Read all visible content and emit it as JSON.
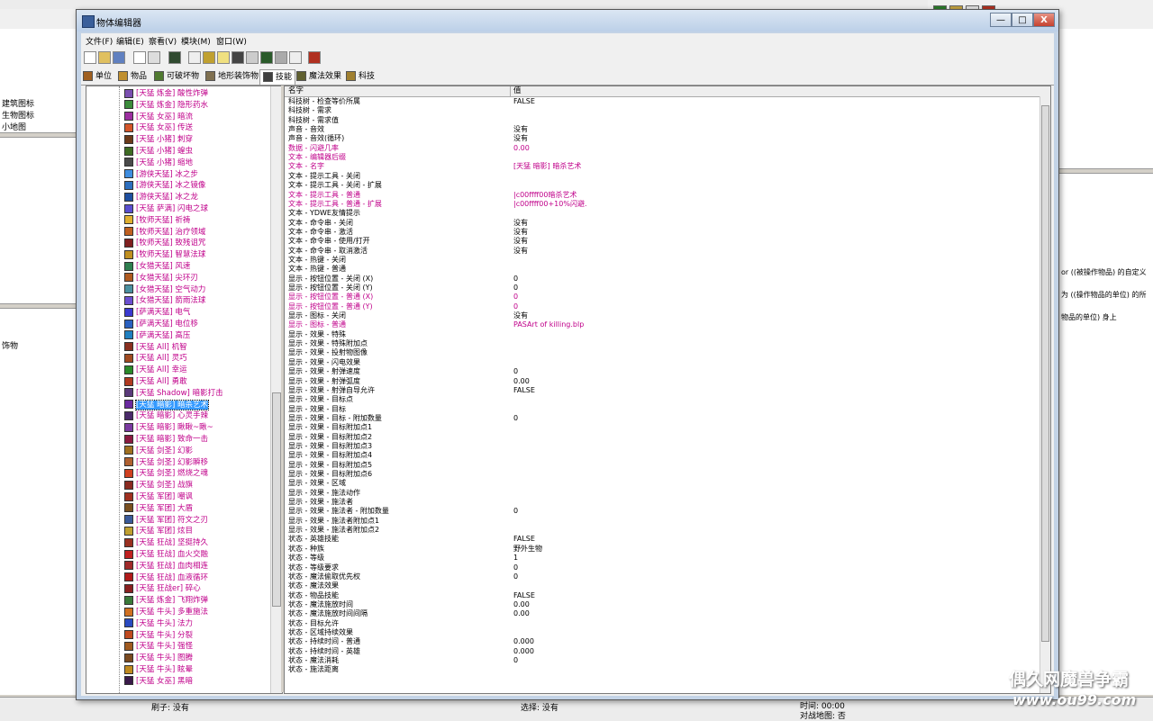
{
  "window": {
    "title": "物体编辑器",
    "controls": {
      "minimize": "—",
      "maximize": "□",
      "close": "X"
    }
  },
  "menu": [
    "文件(F)",
    "编辑(E)",
    "察看(V)",
    "模块(M)",
    "窗口(W)"
  ],
  "tabs": [
    "单位",
    "物品",
    "可破坏物",
    "地形装饰物",
    "技能",
    "魔法效果",
    "科技"
  ],
  "active_tab": 4,
  "tree_items": [
    {
      "label": "[天猛 炼金] 酸性炸弹",
      "color": "#7a4fb0"
    },
    {
      "label": "[天猛 炼金] 隐形药水",
      "color": "#3c8c3c"
    },
    {
      "label": "[天猛 女巫] 暗流",
      "color": "#9c2fa0"
    },
    {
      "label": "[天猛 女巫] 传送",
      "color": "#d4562a"
    },
    {
      "label": "[天猛 小猪] 刺穿",
      "color": "#6b3a1a"
    },
    {
      "label": "[天猛 小猪] 蝗虫",
      "color": "#3e6b23"
    },
    {
      "label": "[天猛 小猪] 缩地",
      "color": "#4a4a4a"
    },
    {
      "label": "[游侠天猛] 冰之步",
      "color": "#3f8de0"
    },
    {
      "label": "[游侠天猛] 冰之镜像",
      "color": "#2d6fbf"
    },
    {
      "label": "[游侠天猛] 冰之龙",
      "color": "#1f4fa0"
    },
    {
      "label": "[天猛 萨满] 闪电之球",
      "color": "#5a4fd0"
    },
    {
      "label": "[牧师天猛] 祈祷",
      "color": "#e0b030"
    },
    {
      "label": "[牧师天猛] 治疗领域",
      "color": "#c06020"
    },
    {
      "label": "[牧师天猛] 致残诅咒",
      "color": "#802020"
    },
    {
      "label": "[牧师天猛] 智慧法球",
      "color": "#c09020"
    },
    {
      "label": "[女猎天猛] 风速",
      "color": "#2f7f4f"
    },
    {
      "label": "[女猎天猛] 尖环刃",
      "color": "#b05a20"
    },
    {
      "label": "[女猎天猛] 空气动力",
      "color": "#4a90a0"
    },
    {
      "label": "[女猎天猛] 箭雨法球",
      "color": "#6b4fd0"
    },
    {
      "label": "[萨满天猛] 电气",
      "color": "#3a3ad0"
    },
    {
      "label": "[萨满天猛] 电位移",
      "color": "#2a60c0"
    },
    {
      "label": "[萨满天猛] 高压",
      "color": "#1f7fc0"
    },
    {
      "label": "[天猛 All] 机智",
      "color": "#8a3020"
    },
    {
      "label": "[天猛 All] 灵巧",
      "color": "#a04a20"
    },
    {
      "label": "[天猛 All] 幸运",
      "color": "#2a8a2a"
    },
    {
      "label": "[天猛 All] 勇敢",
      "color": "#b03a20"
    },
    {
      "label": "[天猛 Shadow] 暗影打击",
      "color": "#5a3a7a"
    },
    {
      "label": "[天猛 暗影] 暗杀艺术",
      "color": "#6a2aa0"
    },
    {
      "label": "[天猛 暗影] 心灵手辣",
      "color": "#4a2a6a"
    },
    {
      "label": "[天猛 暗影] 瞅瞅~瞅~",
      "color": "#7a3aa0"
    },
    {
      "label": "[天猛 暗影] 致命一击",
      "color": "#8a1a40"
    },
    {
      "label": "[天猛 剑圣] 幻影",
      "color": "#a07020"
    },
    {
      "label": "[天猛 剑圣] 幻影瞬移",
      "color": "#b06030"
    },
    {
      "label": "[天猛 剑圣] 燃烧之魂",
      "color": "#d04020"
    },
    {
      "label": "[天猛 剑圣] 战旗",
      "color": "#8a2a20"
    },
    {
      "label": "[天猛 军团] 嘲讽",
      "color": "#a03020"
    },
    {
      "label": "[天猛 军团] 大盾",
      "color": "#7a5020"
    },
    {
      "label": "[天猛 军团] 符文之刃",
      "color": "#3a5a9a"
    },
    {
      "label": "[天猛 军团] 炫目",
      "color": "#c0a030"
    },
    {
      "label": "[天猛 狂战] 坚挺持久",
      "color": "#9a3020"
    },
    {
      "label": "[天猛 狂战] 血火交融",
      "color": "#c02020"
    },
    {
      "label": "[天猛 狂战] 血肉相连",
      "color": "#a02a2a"
    },
    {
      "label": "[天猛 狂战] 血液循环",
      "color": "#b01a1a"
    },
    {
      "label": "[天猛 狂战er] 碎心",
      "color": "#8a2020"
    },
    {
      "label": "[天猛 炼金] 飞翔炸弹",
      "color": "#3a7a3a"
    },
    {
      "label": "[天猛 牛头] 多重施法",
      "color": "#d07020"
    },
    {
      "label": "[天猛 牛头] 法力",
      "color": "#2a4ac0"
    },
    {
      "label": "[天猛 牛头] 分裂",
      "color": "#c04a20"
    },
    {
      "label": "[天猛 牛头] 强怪",
      "color": "#a05a20"
    },
    {
      "label": "[天猛 牛头] 图腾",
      "color": "#7a4a20"
    },
    {
      "label": "[天猛 牛头] 眩晕",
      "color": "#c08a20"
    },
    {
      "label": "[天猛 女巫] 黑暗",
      "color": "#3a1a4a"
    }
  ],
  "selected_tree_index": 27,
  "columns": {
    "name": "名字",
    "value": "值"
  },
  "properties": [
    {
      "name": "科技树 - 检查等价所属",
      "value": "FALSE",
      "mod": false
    },
    {
      "name": "科技树 - 需求",
      "value": "",
      "mod": false
    },
    {
      "name": "科技树 - 需求值",
      "value": "",
      "mod": false
    },
    {
      "name": "声音 - 音效",
      "value": "没有",
      "mod": false
    },
    {
      "name": "声音 - 音效(循环)",
      "value": "没有",
      "mod": false
    },
    {
      "name": "数据 - 闪避几率",
      "value": "0.00",
      "mod": true
    },
    {
      "name": "文本 - 编辑器后缀",
      "value": "",
      "mod": true
    },
    {
      "name": "文本 - 名字",
      "value": "[天猛 暗影] 暗杀艺术",
      "mod": true
    },
    {
      "name": "文本 - 提示工具 - 关闭",
      "value": "",
      "mod": false
    },
    {
      "name": "文本 - 提示工具 - 关闭 - 扩展",
      "value": "",
      "mod": false
    },
    {
      "name": "文本 - 提示工具 - 普通",
      "value": "|c00ffff00暗杀艺术",
      "mod": true
    },
    {
      "name": "文本 - 提示工具 - 普通 - 扩展",
      "value": "|c00ffff00+10%闪避.",
      "mod": true
    },
    {
      "name": "文本 - YDWE友情提示",
      "value": "",
      "mod": false
    },
    {
      "name": "文本 - 命令串 - 关闭",
      "value": "没有",
      "mod": false
    },
    {
      "name": "文本 - 命令串 - 激活",
      "value": "没有",
      "mod": false
    },
    {
      "name": "文本 - 命令串 - 使用/打开",
      "value": "没有",
      "mod": false
    },
    {
      "name": "文本 - 命令串 - 取消激活",
      "value": "没有",
      "mod": false
    },
    {
      "name": "文本 - 热键 - 关闭",
      "value": "",
      "mod": false
    },
    {
      "name": "文本 - 热键 - 普通",
      "value": "",
      "mod": false
    },
    {
      "name": "显示 - 按钮位置 - 关闭 (X)",
      "value": "0",
      "mod": false
    },
    {
      "name": "显示 - 按钮位置 - 关闭 (Y)",
      "value": "0",
      "mod": false
    },
    {
      "name": "显示 - 按钮位置 - 普通 (X)",
      "value": "0",
      "mod": true
    },
    {
      "name": "显示 - 按钮位置 - 普通 (Y)",
      "value": "0",
      "mod": true
    },
    {
      "name": "显示 - 图标 - 关闭",
      "value": "没有",
      "mod": false
    },
    {
      "name": "显示 - 图标 - 普通",
      "value": "PASArt of killing.blp",
      "mod": true
    },
    {
      "name": "显示 - 效果 - 特殊",
      "value": "",
      "mod": false
    },
    {
      "name": "显示 - 效果 - 特殊附加点",
      "value": "",
      "mod": false
    },
    {
      "name": "显示 - 效果 - 投射物图像",
      "value": "",
      "mod": false
    },
    {
      "name": "显示 - 效果 - 闪电效果",
      "value": "",
      "mod": false
    },
    {
      "name": "显示 - 效果 - 射弹速度",
      "value": "0",
      "mod": false
    },
    {
      "name": "显示 - 效果 - 射弹弧度",
      "value": "0.00",
      "mod": false
    },
    {
      "name": "显示 - 效果 - 射弹自导允许",
      "value": "FALSE",
      "mod": false
    },
    {
      "name": "显示 - 效果 - 目标点",
      "value": "",
      "mod": false
    },
    {
      "name": "显示 - 效果 - 目标",
      "value": "",
      "mod": false
    },
    {
      "name": "显示 - 效果 - 目标 - 附加数量",
      "value": "0",
      "mod": false
    },
    {
      "name": "显示 - 效果 - 目标附加点1",
      "value": "",
      "mod": false
    },
    {
      "name": "显示 - 效果 - 目标附加点2",
      "value": "",
      "mod": false
    },
    {
      "name": "显示 - 效果 - 目标附加点3",
      "value": "",
      "mod": false
    },
    {
      "name": "显示 - 效果 - 目标附加点4",
      "value": "",
      "mod": false
    },
    {
      "name": "显示 - 效果 - 目标附加点5",
      "value": "",
      "mod": false
    },
    {
      "name": "显示 - 效果 - 目标附加点6",
      "value": "",
      "mod": false
    },
    {
      "name": "显示 - 效果 - 区域",
      "value": "",
      "mod": false
    },
    {
      "name": "显示 - 效果 - 施法动作",
      "value": "",
      "mod": false
    },
    {
      "name": "显示 - 效果 - 施法者",
      "value": "",
      "mod": false
    },
    {
      "name": "显示 - 效果 - 施法者 - 附加数量",
      "value": "0",
      "mod": false
    },
    {
      "name": "显示 - 效果 - 施法者附加点1",
      "value": "",
      "mod": false
    },
    {
      "name": "显示 - 效果 - 施法者附加点2",
      "value": "",
      "mod": false
    },
    {
      "name": "状态 - 英雄技能",
      "value": "FALSE",
      "mod": false
    },
    {
      "name": "状态 - 种族",
      "value": "野外生物",
      "mod": false
    },
    {
      "name": "状态 - 等级",
      "value": "1",
      "mod": false
    },
    {
      "name": "状态 - 等级要求",
      "value": "0",
      "mod": false
    },
    {
      "name": "状态 - 魔法偷取优先权",
      "value": "0",
      "mod": false
    },
    {
      "name": "状态 - 魔法效果",
      "value": "",
      "mod": false
    },
    {
      "name": "状态 - 物品技能",
      "value": "FALSE",
      "mod": false
    },
    {
      "name": "状态 - 魔法施放时间",
      "value": "0.00",
      "mod": false
    },
    {
      "name": "状态 - 魔法施放时间间隔",
      "value": "0.00",
      "mod": false
    },
    {
      "name": "状态 - 目标允许",
      "value": "",
      "mod": false
    },
    {
      "name": "状态 - 区域持续效果",
      "value": "",
      "mod": false
    },
    {
      "name": "状态 - 持续时间 - 普通",
      "value": "0.000",
      "mod": false
    },
    {
      "name": "状态 - 持续时间 - 英雄",
      "value": "0.000",
      "mod": false
    },
    {
      "name": "状态 - 魔法消耗",
      "value": "0",
      "mod": false
    },
    {
      "name": "状态 - 施法距离",
      "value": "",
      "mod": false
    }
  ],
  "background": {
    "left_labels": [
      "建筑图标",
      "生物图标",
      "小地图",
      "饰物"
    ],
    "right_texts": [
      "or ((被操作物品) 的自定义",
      "为 ((操作物品的单位) 的所",
      "物品的单位) 身上"
    ],
    "status": {
      "brush": "刷子: 没有",
      "select": "选择: 没有",
      "time": "时间: 00:00",
      "battle_map": "对战地图: 否"
    }
  },
  "watermark": {
    "line1": "偶久网魔兽争霸",
    "line2": "www.ou99.com"
  }
}
